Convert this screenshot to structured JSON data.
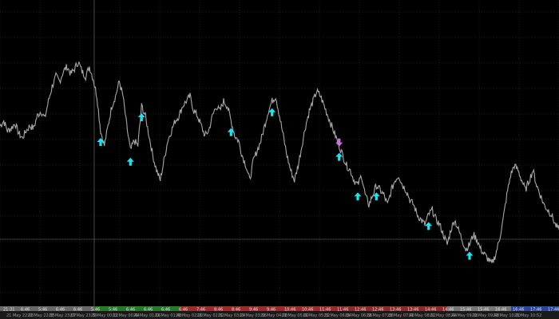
{
  "chart_data": {
    "type": "line",
    "title": "",
    "xlabel": "",
    "ylabel": "",
    "grid": true,
    "colors": {
      "background": "#000000",
      "grid": "#3a3a3a",
      "price_line": "#a8a8a8",
      "buy_arrow": "#19e6f0",
      "sell_arrow": "#d070e0",
      "axis_strip": "#1a1a1a",
      "crosshair": "#7a7a7a"
    },
    "ylim": [
      0,
      100
    ],
    "series": [
      {
        "values": [
          62,
          64,
          60,
          61,
          63,
          59,
          57,
          60,
          62,
          61,
          66,
          68,
          65,
          72,
          78,
          82,
          80,
          84,
          86,
          83,
          85,
          88,
          84,
          82,
          86,
          81,
          74,
          60,
          54,
          62,
          70,
          74,
          80,
          74,
          62,
          52,
          56,
          54,
          70,
          66,
          58,
          50,
          44,
          40,
          48,
          56,
          60,
          64,
          66,
          70,
          72,
          74,
          68,
          66,
          62,
          58,
          60,
          66,
          70,
          68,
          72,
          70,
          64,
          58,
          56,
          50,
          46,
          40,
          48,
          52,
          56,
          62,
          68,
          72,
          74,
          66,
          58,
          50,
          44,
          40,
          46,
          54,
          62,
          68,
          72,
          76,
          74,
          70,
          66,
          62,
          58,
          54,
          50,
          46,
          44,
          40,
          38,
          42,
          34,
          30,
          34,
          38,
          36,
          34,
          30,
          36,
          40,
          42,
          38,
          36,
          32,
          30,
          26,
          24,
          22,
          26,
          28,
          24,
          22,
          18,
          14,
          20,
          24,
          20,
          16,
          12,
          14,
          18,
          16,
          12,
          10,
          8,
          6,
          10,
          16,
          24,
          34,
          42,
          46,
          44,
          40,
          36,
          40,
          44,
          38,
          34,
          30,
          28,
          26,
          22,
          20
        ]
      }
    ],
    "buy_signals": [
      27,
      35,
      38,
      62,
      73,
      91,
      96,
      101,
      115,
      126
    ],
    "sell_signals": [
      91
    ],
    "x_ticks": [
      "21 May 22:03",
      "21 May 22:35",
      "21 May 23:07",
      "20 May 23:39",
      "21 May 00:12",
      "21 May 00:44",
      "21 May 01:16",
      "21 May 01:48",
      "21 May 02:20",
      "21 May 02:52",
      "21 May 03:24",
      "21 May 03:56",
      "21 May 04:28",
      "21 May 05:00",
      "21 May 05:32",
      "21 May 06:04",
      "21 May 06:36",
      "21 May 07:08",
      "21 May 07:40",
      "21 May 08:12",
      "21 May 08:44",
      "21 May 09:16",
      "21 May 09:48",
      "21 May 10:20",
      "21 May 10:52"
    ],
    "upper_ticks": [
      "21:31",
      "6:46",
      "5:46",
      "6:46",
      "6:46",
      "5:46",
      "5:46",
      "6:46",
      "6:46",
      "6:46",
      "6:46",
      "7:46",
      "8:46",
      "8:46",
      "9:46",
      "9:46",
      "10:46",
      "10:46",
      "11:46",
      "11:46",
      "12:46",
      "12:46",
      "13:46",
      "13:46",
      "14:46",
      "14:46",
      "15:46",
      "15:46",
      "16:46",
      "16:46",
      "17:46",
      "17:46"
    ]
  }
}
